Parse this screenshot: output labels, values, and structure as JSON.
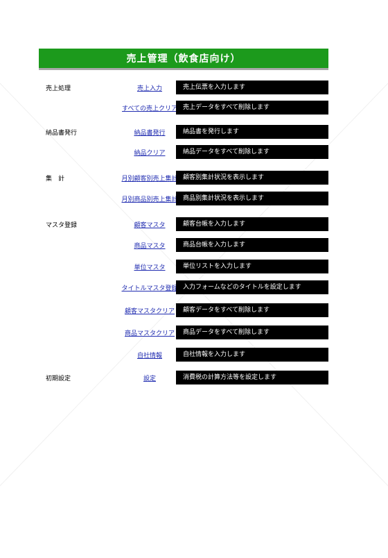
{
  "header": {
    "title": "売上管理（飲食店向け）"
  },
  "rows": [
    {
      "category": "売上処理",
      "link": "売上入力",
      "desc": "売上伝票を入力します"
    },
    {
      "category": "",
      "link": "すべての売上クリア",
      "desc": "売上データをすべて削除します"
    },
    {
      "category": "納品書発行",
      "link": "納品書発行",
      "desc": "納品書を発行します"
    },
    {
      "category": "",
      "link": "納品クリア",
      "desc": "納品データをすべて削除します"
    },
    {
      "category": "集　計",
      "link": "月別顧客別売上集計",
      "desc": "顧客別集計状況を表示します"
    },
    {
      "category": "",
      "link": "月別商品別売上集計",
      "desc": "商品別集計状況を表示します"
    },
    {
      "category": "マスタ登録",
      "link": "顧客マスタ",
      "desc": "顧客台帳を入力します"
    },
    {
      "category": "",
      "link": "商品マスタ",
      "desc": "商品台帳を入力します"
    },
    {
      "category": "",
      "link": "単位マスタ",
      "desc": "単位リストを入力します"
    },
    {
      "category": "",
      "link": "タイトルマスタ登録",
      "desc": "入力フォームなどのタイトルを設定します"
    },
    {
      "category": "",
      "link": "顧客マスタクリア",
      "desc": "顧客データをすべて削除します"
    },
    {
      "category": "",
      "link": "商品マスタクリア",
      "desc": "商品データをすべて削除します"
    },
    {
      "category": "",
      "link": "自社情報",
      "desc": "自社情報を入力します"
    },
    {
      "category": "初期設定",
      "link": "設定",
      "desc": "消費税の計算方法等を設定します"
    }
  ]
}
